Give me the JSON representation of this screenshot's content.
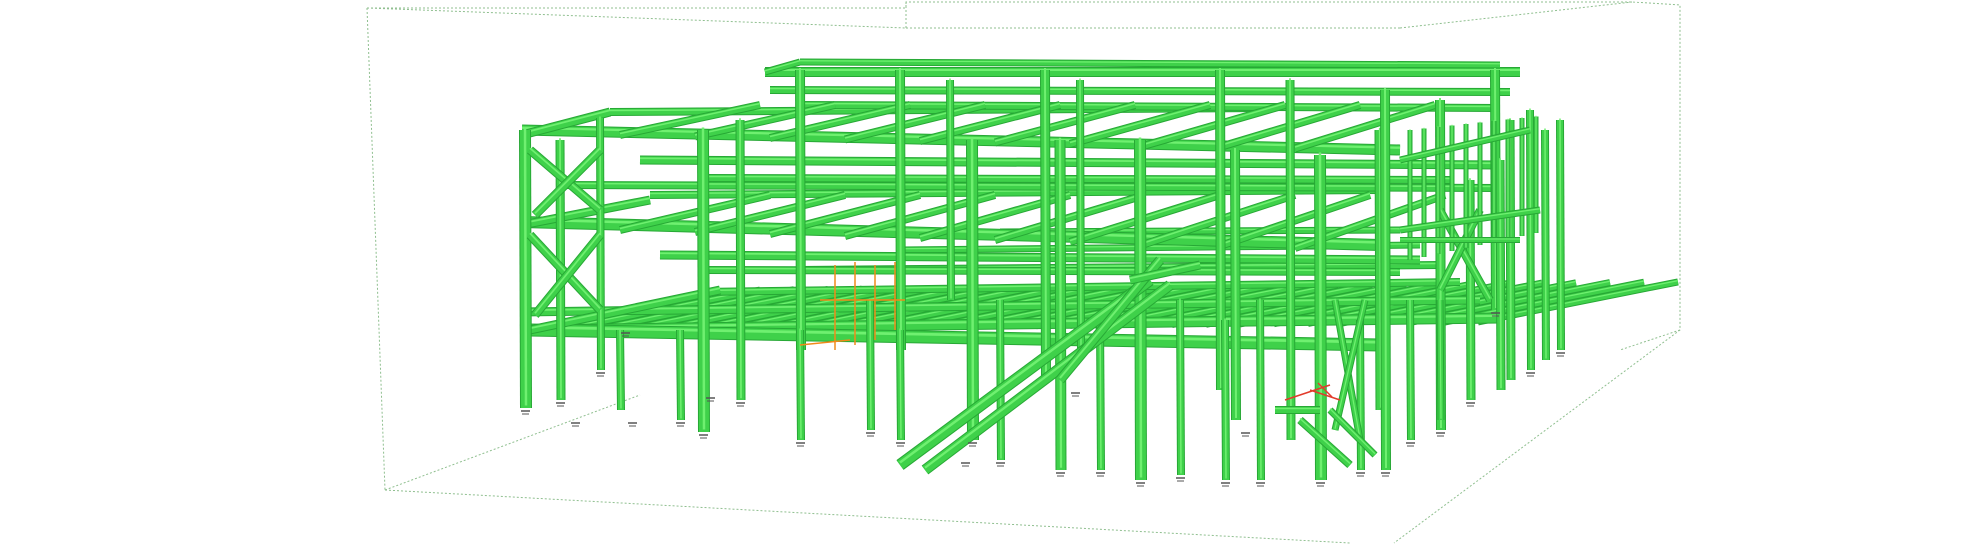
{
  "viewport": {
    "background": "#ffffff",
    "model": {
      "type": "3d-structural-steel-frame",
      "member_color": "#3fd14a",
      "member_color_dark": "#27a835",
      "member_color_light": "#6ff070",
      "highlight_color": "#f08a1a",
      "selection_color": "#e23b2b",
      "bounding_box_color": "#8fbf8f",
      "support_color": "#555555"
    }
  }
}
